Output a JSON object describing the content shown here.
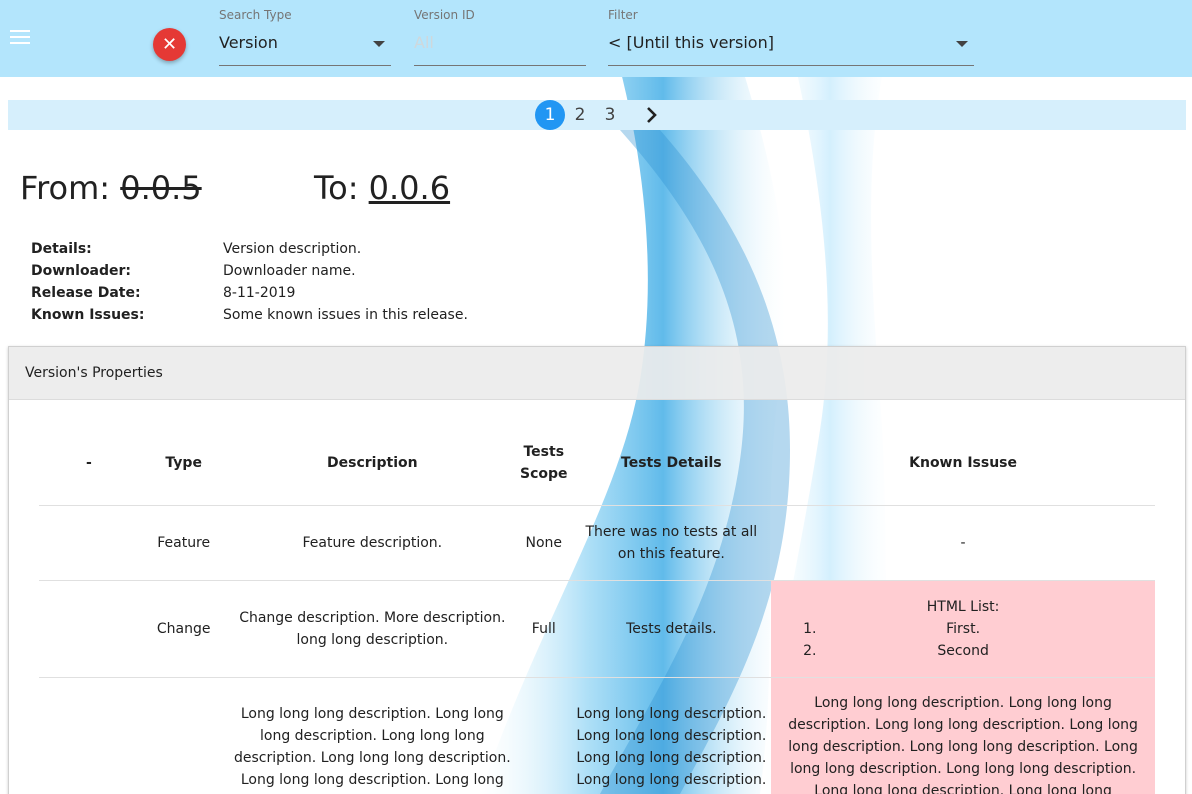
{
  "header": {
    "search_type_label": "Search Type",
    "search_type_value": "Version",
    "version_id_label": "Version ID",
    "version_id_placeholder": "All",
    "filter_label": "Filter",
    "filter_value": "< [Until this version]"
  },
  "pagination": {
    "pages": [
      "1",
      "2",
      "3"
    ],
    "active": "1"
  },
  "versions": {
    "from_label": "From:",
    "from_value": "0.0.5",
    "to_label": "To:",
    "to_value": "0.0.6"
  },
  "details": [
    {
      "key": "Details:",
      "value": "Version description."
    },
    {
      "key": "Downloader:",
      "value": "Downloader name."
    },
    {
      "key": "Release Date:",
      "value": "8-11-2019"
    },
    {
      "key": "Known Issues:",
      "value": "Some known issues in this release."
    }
  ],
  "panel": {
    "title": "Version's Properties",
    "columns": [
      "-",
      "Type",
      "Description",
      "Tests Scope",
      "Tests Details",
      "Known Issuse"
    ],
    "rows": [
      {
        "dash": "",
        "type": "Feature",
        "description": "Feature description.",
        "scope": "None",
        "tests_details": "There was no tests at all on this feature.",
        "known_issue": "-"
      },
      {
        "dash": "",
        "type": "Change",
        "description": "Change description. More description. long long description.",
        "scope": "Full",
        "tests_details": "Tests details.",
        "known_issue_title": "HTML List:",
        "known_issue_items": [
          "First.",
          "Second"
        ],
        "known_issue_item_numbers": [
          "1.",
          "2."
        ]
      },
      {
        "dash": "",
        "type": "",
        "description": "Long long long description. Long long long description. Long long long description. Long long long description. Long long long description. Long long",
        "scope": "",
        "tests_details": "Long long long description. Long long long description. Long long long description. Long long long description.",
        "known_issue": "Long long long description. Long long long description. Long long long description. Long long long description. Long long long description. Long long long description. Long long long description. Long long long description. Long long long description. Long long long"
      }
    ]
  },
  "colors": {
    "app_bar": "#b3e5fc",
    "clear_button": "#e53935",
    "active_page": "#2196f3",
    "issue_highlight": "#ffcdd2"
  },
  "icons": [
    "menu-icon",
    "close-icon",
    "dropdown-caret-icon",
    "chevron-right-icon"
  ]
}
